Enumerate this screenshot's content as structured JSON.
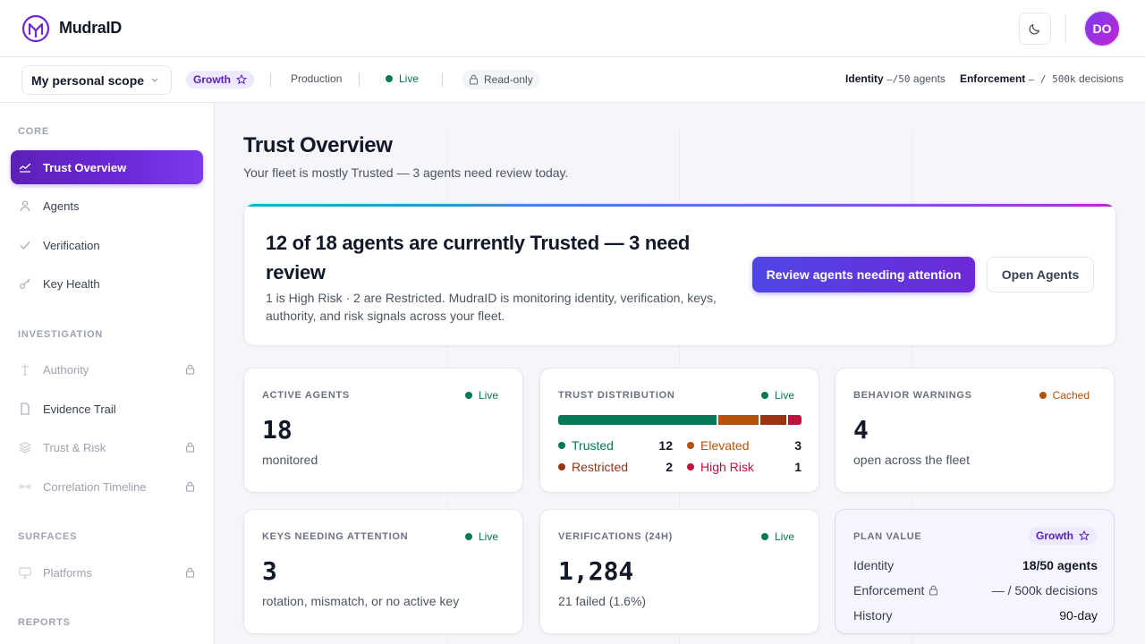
{
  "app": {
    "name": "MudraID",
    "avatar_initials": "DO"
  },
  "subbar": {
    "scope": "My personal scope",
    "plan": "Growth",
    "environment": "Production",
    "status": "Live",
    "mode": "Read-only",
    "quota_identity_label": "Identity",
    "quota_identity_value": "–/50",
    "quota_identity_unit": "agents",
    "quota_enforcement_label": "Enforcement",
    "quota_enforcement_value": "– / 500k",
    "quota_enforcement_unit": "decisions"
  },
  "sidebar": {
    "sections": [
      "CORE",
      "INVESTIGATION",
      "SURFACES",
      "REPORTS"
    ],
    "items": [
      {
        "label": "Trust Overview",
        "icon": "chart-line-icon",
        "active": true,
        "locked": false
      },
      {
        "label": "Agents",
        "icon": "user-icon",
        "active": false,
        "locked": false
      },
      {
        "label": "Verification",
        "icon": "check-icon",
        "active": false,
        "locked": false
      },
      {
        "label": "Key Health",
        "icon": "key-icon",
        "active": false,
        "locked": false
      },
      {
        "label": "Authority",
        "icon": "authority-icon",
        "active": false,
        "locked": true
      },
      {
        "label": "Evidence Trail",
        "icon": "document-icon",
        "active": false,
        "locked": false
      },
      {
        "label": "Trust & Risk",
        "icon": "layers-icon",
        "active": false,
        "locked": true
      },
      {
        "label": "Correlation Timeline",
        "icon": "timeline-icon",
        "active": false,
        "locked": true
      },
      {
        "label": "Platforms",
        "icon": "monitor-icon",
        "active": false,
        "locked": true
      }
    ]
  },
  "page": {
    "title": "Trust Overview",
    "subtitle": "Your fleet is mostly Trusted — 3 agents need review today."
  },
  "hero": {
    "headline": "12 of 18 agents are currently Trusted — 3 need review",
    "body": "1 is High Risk · 2 are Restricted. MudraID is monitoring identity, verification, keys, authority, and risk signals across your fleet.",
    "primary_button": "Review agents needing attention",
    "secondary_button": "Open Agents"
  },
  "cards": {
    "active_agents": {
      "label": "ACTIVE AGENTS",
      "status": "Live",
      "value": "18",
      "note": "monitored"
    },
    "trust_distribution": {
      "label": "TRUST DISTRIBUTION",
      "status": "Live",
      "segments": [
        {
          "name": "Trusted",
          "value": 12,
          "color": "#047857"
        },
        {
          "name": "Elevated",
          "value": 3,
          "color": "#b45309"
        },
        {
          "name": "Restricted",
          "value": 2,
          "color": "#9a3412"
        },
        {
          "name": "High Risk",
          "value": 1,
          "color": "#be123c"
        }
      ]
    },
    "behavior_warnings": {
      "label": "BEHAVIOR WARNINGS",
      "status": "Cached",
      "value": "4",
      "note": "open across the fleet"
    },
    "keys_attention": {
      "label": "KEYS NEEDING ATTENTION",
      "status": "Live",
      "value": "3",
      "note": "rotation, mismatch, or no active key"
    },
    "verifications": {
      "label": "VERIFICATIONS (24H)",
      "status": "Live",
      "value": "1,284",
      "note": "21 failed (1.6%)"
    },
    "plan_value": {
      "label": "PLAN VALUE",
      "plan": "Growth",
      "rows": [
        {
          "label": "Identity",
          "value": "18/50 agents",
          "locked": false
        },
        {
          "label": "Enforcement",
          "value": "— / 500k decisions",
          "locked": true
        },
        {
          "label": "History",
          "value": "90-day",
          "locked": false
        }
      ]
    }
  },
  "colors": {
    "accent": "#5b21b6",
    "live": "#047857",
    "cached": "#b45309"
  }
}
